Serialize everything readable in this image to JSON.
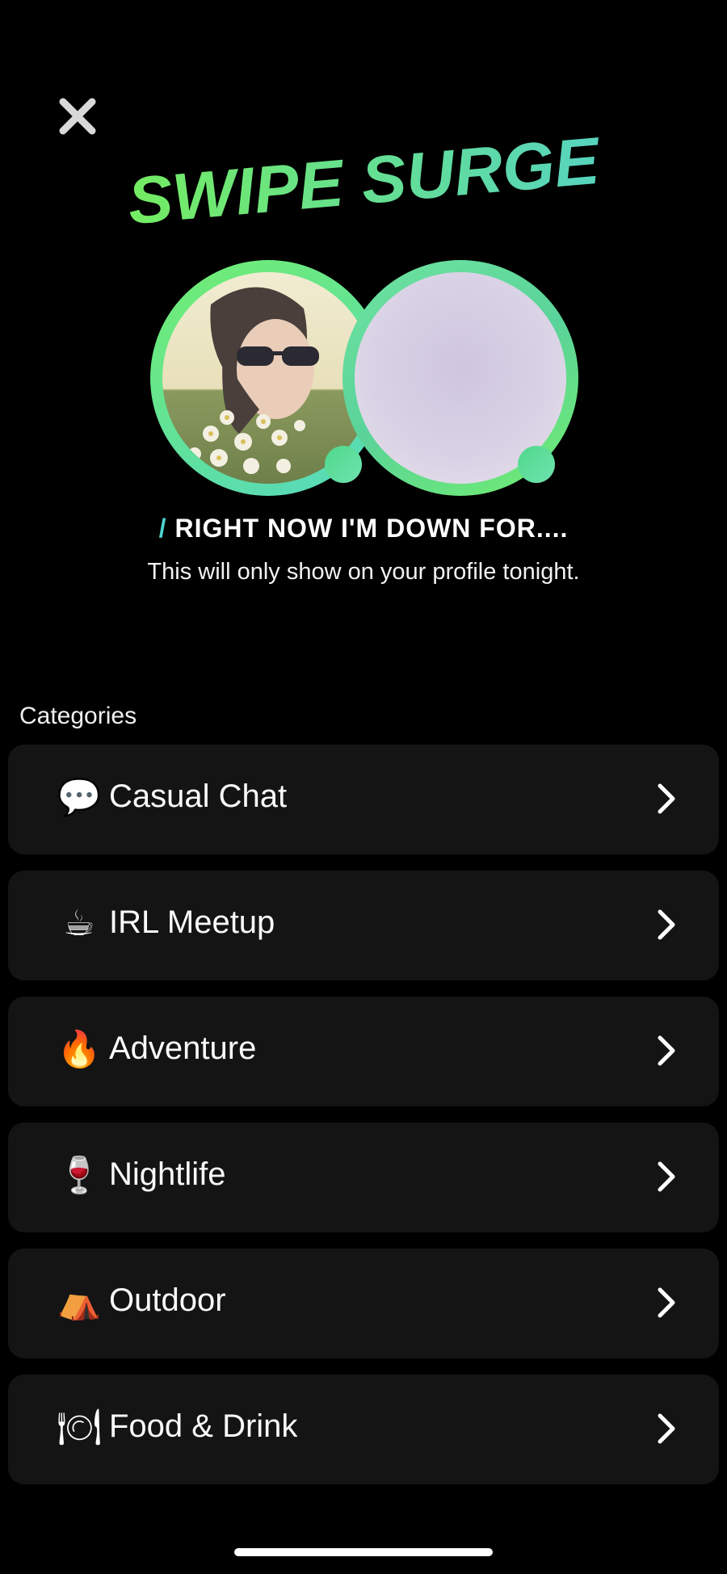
{
  "header": {
    "close_icon": "close-icon",
    "title": "SWIPE SURGE",
    "title_gradient": [
      "#74ec62",
      "#57d3bf"
    ]
  },
  "avatars": [
    {
      "name": "profile-photo",
      "kind": "photo"
    },
    {
      "name": "empty-avatar",
      "kind": "placeholder"
    }
  ],
  "prompt": {
    "slash": "/",
    "heading": "RIGHT NOW I'M DOWN FOR....",
    "subtext": "This will only show on your profile tonight."
  },
  "categories": {
    "section_label": "Categories",
    "items": [
      {
        "emoji": "💬",
        "icon": "speech-bubble-icon",
        "label": "Casual Chat"
      },
      {
        "emoji": "☕",
        "icon": "coffee-icon",
        "label": "IRL Meetup"
      },
      {
        "emoji": "🔥",
        "icon": "fire-icon",
        "label": "Adventure"
      },
      {
        "emoji": "🍷",
        "icon": "wine-glass-icon",
        "label": "Nightlife"
      },
      {
        "emoji": "⛺",
        "icon": "tent-icon",
        "label": "Outdoor"
      },
      {
        "emoji": "🍽",
        "icon": "plate-icon",
        "label": "Food & Drink"
      }
    ]
  },
  "colors": {
    "background": "#000000",
    "card": "#141414",
    "accent_green": "#72ee6e",
    "accent_teal": "#4fd2d0"
  }
}
